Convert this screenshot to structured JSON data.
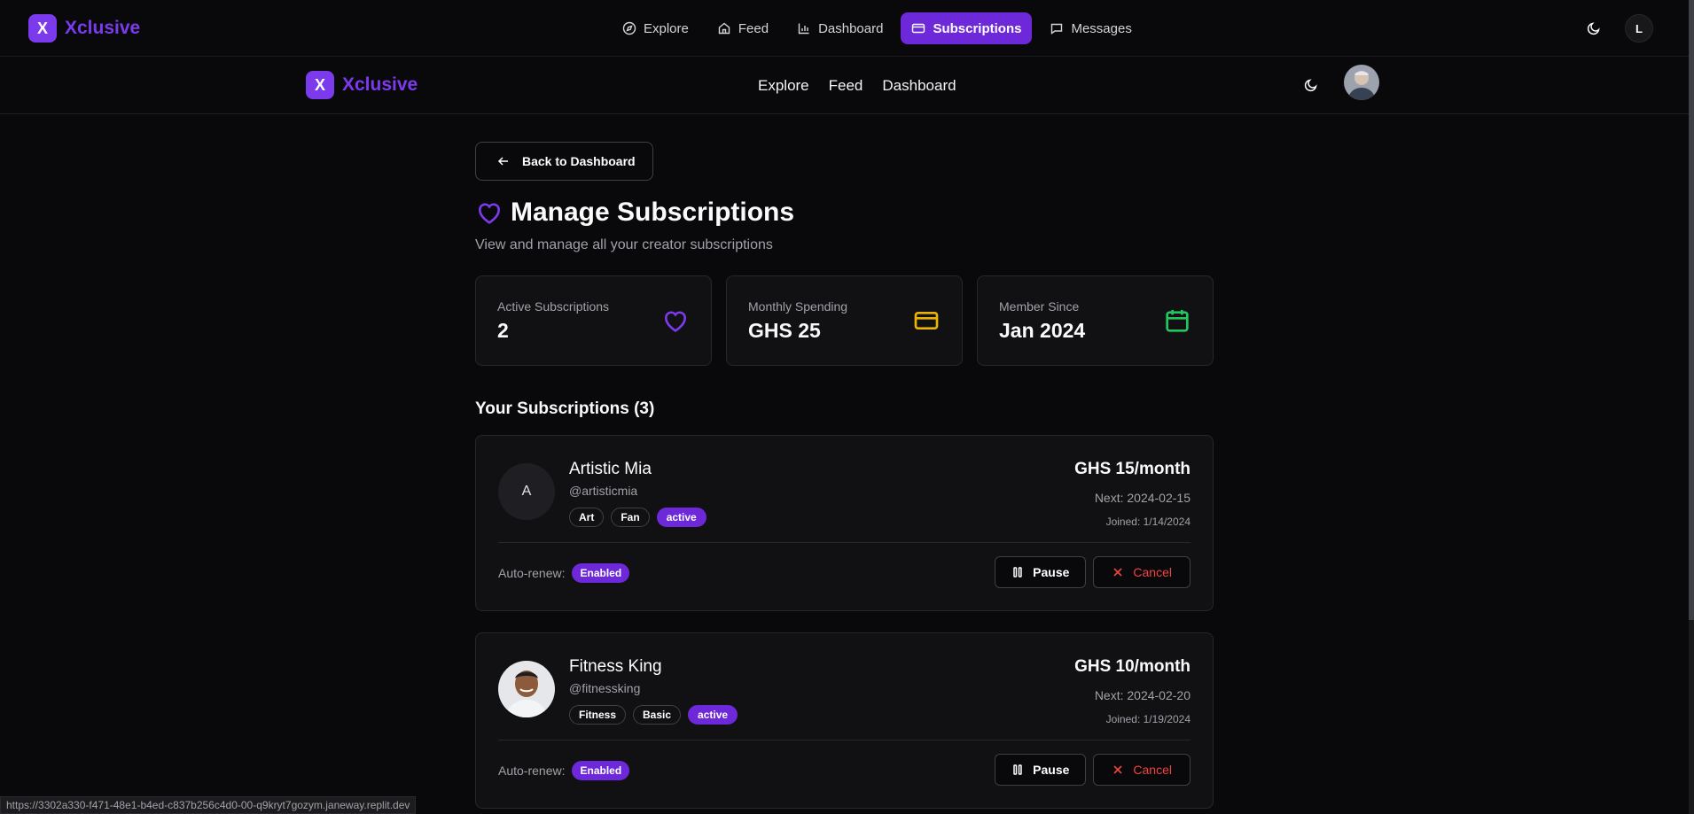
{
  "topnav": {
    "brand_letter": "X",
    "brand_name": "Xclusive",
    "links": [
      {
        "label": "Explore",
        "icon": "compass-icon"
      },
      {
        "label": "Feed",
        "icon": "home-icon"
      },
      {
        "label": "Dashboard",
        "icon": "bar-chart-icon"
      },
      {
        "label": "Subscriptions",
        "icon": "card-icon"
      },
      {
        "label": "Messages",
        "icon": "message-icon"
      }
    ],
    "active_link": "Subscriptions",
    "user_initial": "L"
  },
  "subnav": {
    "brand_letter": "X",
    "brand_name": "Xclusive",
    "links": [
      "Explore",
      "Feed",
      "Dashboard"
    ]
  },
  "main": {
    "back_label": "Back to Dashboard",
    "title": "Manage Subscriptions",
    "subtitle": "View and manage all your creator subscriptions",
    "stats": [
      {
        "label": "Active Subscriptions",
        "value": "2",
        "icon": "heart-icon",
        "color": "#7c3aed"
      },
      {
        "label": "Monthly Spending",
        "value": "GHS 25",
        "icon": "credit-card-icon",
        "color": "#eab308"
      },
      {
        "label": "Member Since",
        "value": "Jan 2024",
        "icon": "calendar-icon",
        "color": "#22c55e"
      }
    ],
    "section_title": "Your Subscriptions (3)",
    "subscriptions": [
      {
        "avatar_initial": "A",
        "name": "Artistic Mia",
        "handle": "@artisticmia",
        "tags": [
          "Art",
          "Fan",
          "active"
        ],
        "price": "GHS 15/month",
        "next": "Next: 2024-02-15",
        "joined": "Joined: 1/14/2024",
        "autorenew_label": "Auto-renew:",
        "autorenew_value": "Enabled",
        "pause_label": "Pause",
        "cancel_label": "Cancel"
      },
      {
        "avatar_initial": "",
        "name": "Fitness King",
        "handle": "@fitnessking",
        "tags": [
          "Fitness",
          "Basic",
          "active"
        ],
        "price": "GHS 10/month",
        "next": "Next: 2024-02-20",
        "joined": "Joined: 1/19/2024",
        "autorenew_label": "Auto-renew:",
        "autorenew_value": "Enabled",
        "pause_label": "Pause",
        "cancel_label": "Cancel"
      }
    ]
  },
  "status_url": "https://3302a330-f471-48e1-b4ed-c837b256c4d0-00-q9kryt7gozym.janeway.replit.dev",
  "colors": {
    "accent": "#7c3aed",
    "accent_dark": "#6d28d9",
    "danger": "#ef4444"
  }
}
